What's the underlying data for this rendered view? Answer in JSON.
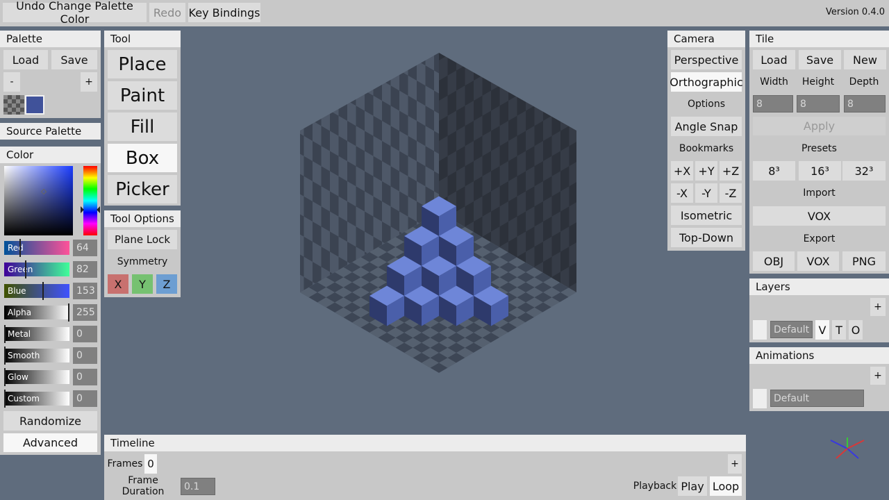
{
  "topbar": {
    "undo_label": "Undo Change Palette Color",
    "redo_label": "Redo",
    "keybindings_label": "Key Bindings",
    "version": "Version 0.4.0"
  },
  "palette": {
    "title": "Palette",
    "load": "Load",
    "save": "Save",
    "minus": "-",
    "plus": "+",
    "swatch_color": "#40529a"
  },
  "source_palette": {
    "title": "Source Palette"
  },
  "color": {
    "title": "Color",
    "channels": [
      {
        "label": "Red",
        "value": "64"
      },
      {
        "label": "Green",
        "value": "82"
      },
      {
        "label": "Blue",
        "value": "153"
      },
      {
        "label": "Alpha",
        "value": "255"
      },
      {
        "label": "Metal",
        "value": "0"
      },
      {
        "label": "Smooth",
        "value": "0"
      },
      {
        "label": "Glow",
        "value": "0"
      },
      {
        "label": "Custom",
        "value": "0"
      }
    ],
    "randomize": "Randomize",
    "advanced": "Advanced"
  },
  "tool": {
    "title": "Tool",
    "items": [
      "Place",
      "Paint",
      "Fill",
      "Box",
      "Picker"
    ],
    "selected": "Box"
  },
  "tool_options": {
    "title": "Tool Options",
    "plane_lock": "Plane Lock",
    "symmetry": "Symmetry",
    "x": "X",
    "y": "Y",
    "z": "Z"
  },
  "camera": {
    "title": "Camera",
    "perspective": "Perspective",
    "orthographic": "Orthographic",
    "options": "Options",
    "angle_snap": "Angle Snap",
    "bookmarks": "Bookmarks",
    "px": "+X",
    "py": "+Y",
    "pz": "+Z",
    "nx": "-X",
    "ny": "-Y",
    "nz": "-Z",
    "isometric": "Isometric",
    "topdown": "Top-Down"
  },
  "tile": {
    "title": "Tile",
    "load": "Load",
    "save": "Save",
    "new": "New",
    "width_label": "Width",
    "height_label": "Height",
    "depth_label": "Depth",
    "width": "8",
    "height": "8",
    "depth": "8",
    "apply": "Apply",
    "presets": "Presets",
    "p8": "8³",
    "p16": "16³",
    "p32": "32³",
    "import": "Import",
    "import_vox": "VOX",
    "export": "Export",
    "obj": "OBJ",
    "vox": "VOX",
    "png": "PNG"
  },
  "layers": {
    "title": "Layers",
    "add": "+",
    "layer_name": "Default",
    "v": "V",
    "t": "T",
    "o": "O"
  },
  "animations": {
    "title": "Animations",
    "add": "+",
    "anim_name": "Default"
  },
  "timeline": {
    "title": "Timeline",
    "frames_label": "Frames",
    "frames_value": "0",
    "add": "+",
    "duration_label": "Frame Duration",
    "duration_value": "0.1",
    "playback_label": "Playback",
    "play": "Play",
    "loop": "Loop"
  }
}
